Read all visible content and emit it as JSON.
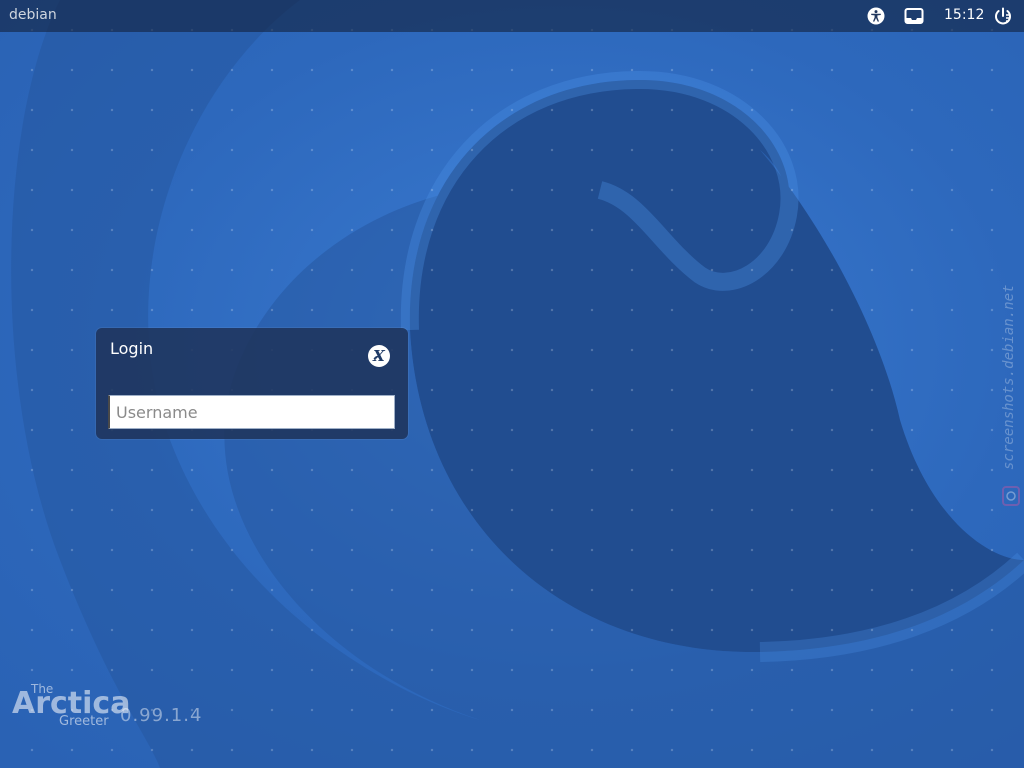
{
  "top_panel": {
    "hostname": "debian",
    "clock": "15:12",
    "icons": [
      "accessibility-icon",
      "keyboard-icon",
      "power-icon"
    ]
  },
  "login": {
    "title": "Login",
    "session_icon": "xfce-session-icon",
    "username_placeholder": "Username",
    "username_value": ""
  },
  "branding": {
    "the": "The",
    "name": "Arctica",
    "greeter": "Greeter",
    "version": "0.99.1.4"
  },
  "watermark": {
    "text": "screenshots.debian.net"
  },
  "colors": {
    "background": "#2f69be",
    "spiral_dark": "#1f4f93",
    "panel": "#14243f",
    "login_box": "#1f345c"
  }
}
